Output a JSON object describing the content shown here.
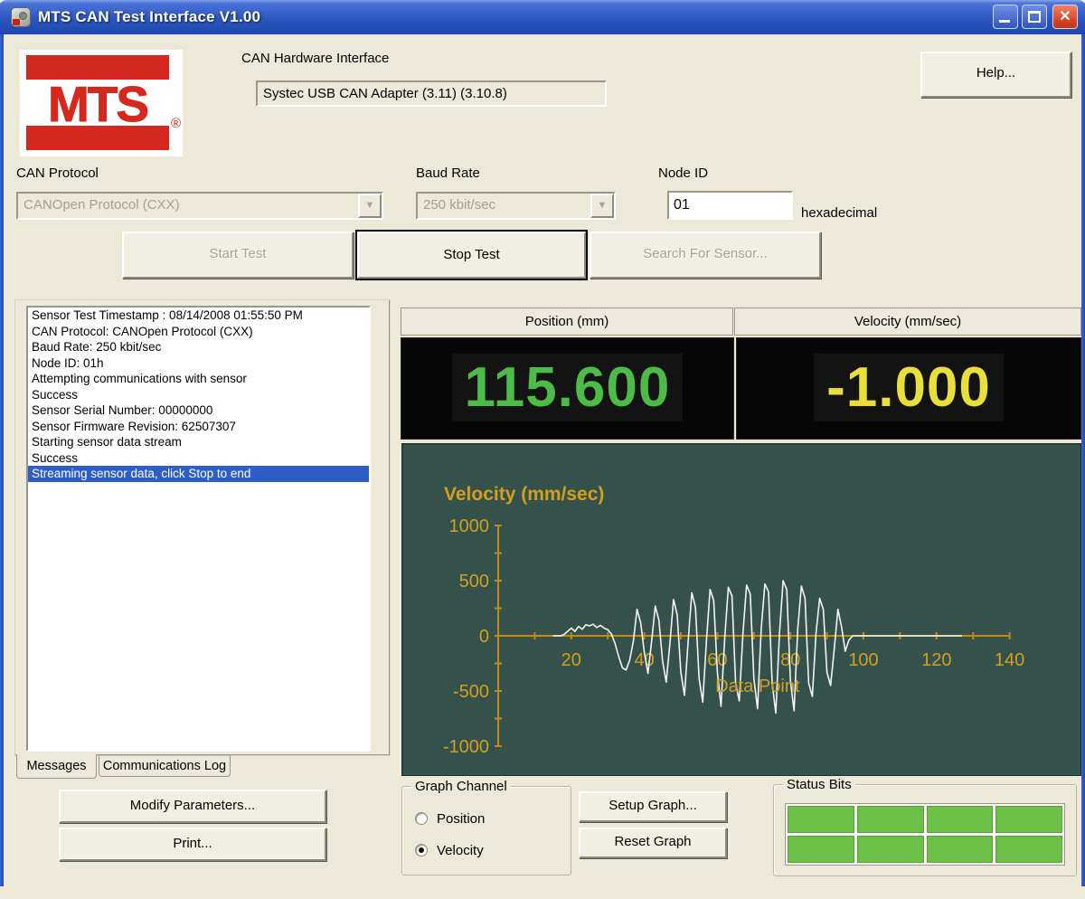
{
  "window": {
    "title": "MTS CAN Test Interface V1.00",
    "close_glyph": "✕"
  },
  "header": {
    "logo_text": "MTS",
    "logo_registered": "®",
    "hardware_label": "CAN Hardware Interface",
    "hardware_value": "Systec USB CAN Adapter (3.11) (3.10.8)",
    "help_label": "Help..."
  },
  "settings": {
    "can_protocol": {
      "label": "CAN Protocol",
      "value": "CANOpen Protocol (CXX)"
    },
    "baud_rate": {
      "label": "Baud Rate",
      "value": "250 kbit/sec"
    },
    "node_id": {
      "label": "Node ID",
      "value": "01",
      "suffix": "hexadecimal"
    },
    "dropdown_glyph": "▼"
  },
  "actions": {
    "start": "Start Test",
    "stop": "Stop Test",
    "search": "Search For Sensor..."
  },
  "log": {
    "tabs": [
      "Messages",
      "Communications Log"
    ],
    "active_tab": "Messages",
    "selected_index": 10,
    "messages": [
      "Sensor Test Timestamp : 08/14/2008 01:55:50 PM",
      "CAN Protocol: CANOpen Protocol (CXX)",
      "Baud Rate: 250 kbit/sec",
      "Node ID: 01h",
      "Attempting communications with sensor",
      "Success",
      "Sensor Serial Number: 00000000",
      "Sensor Firmware Revision: 62507307",
      "Starting sensor data stream",
      "Success",
      "Streaming sensor data, click Stop to end"
    ],
    "buttons": {
      "modify": "Modify Parameters...",
      "print": "Print..."
    }
  },
  "displays": {
    "position": {
      "header": "Position (mm)",
      "value": "115.600",
      "color": "#4CBB48"
    },
    "velocity": {
      "header": "Velocity (mm/sec)",
      "value": "-1.000",
      "color": "#E8DE3C"
    }
  },
  "chart_data": {
    "type": "line",
    "title": "Velocity (mm/sec)",
    "xlabel": "Data Point",
    "ylabel": "",
    "xlim": [
      0,
      140
    ],
    "ylim": [
      -1000,
      1000
    ],
    "x_major_ticks": [
      20,
      40,
      60,
      80,
      100,
      120,
      140
    ],
    "x_minor_step": 10,
    "y_major_ticks": [
      -1000,
      -500,
      0,
      500,
      1000
    ],
    "y_minor_step": 250,
    "grid": false,
    "bg_color": "#35514C",
    "axis_color": "#BE8C14",
    "label_color": "#D2A01E",
    "line_color": "#F2F5F2",
    "series": [
      {
        "name": "Velocity",
        "points": [
          [
            15,
            0
          ],
          [
            17,
            0
          ],
          [
            18,
            10
          ],
          [
            19,
            40
          ],
          [
            20,
            70
          ],
          [
            21,
            40
          ],
          [
            22,
            85
          ],
          [
            23,
            60
          ],
          [
            24,
            100
          ],
          [
            25,
            90
          ],
          [
            26,
            105
          ],
          [
            27,
            75
          ],
          [
            28,
            95
          ],
          [
            29,
            70
          ],
          [
            30,
            55
          ],
          [
            31,
            15
          ],
          [
            32,
            -70
          ],
          [
            33,
            -190
          ],
          [
            34,
            -290
          ],
          [
            35,
            -310
          ],
          [
            36,
            -220
          ],
          [
            37,
            -50
          ],
          [
            38,
            240
          ],
          [
            39,
            120
          ],
          [
            40,
            -150
          ],
          [
            41,
            -340
          ],
          [
            42,
            -50
          ],
          [
            43,
            270
          ],
          [
            44,
            140
          ],
          [
            45,
            -230
          ],
          [
            46,
            -420
          ],
          [
            47,
            -70
          ],
          [
            48,
            330
          ],
          [
            49,
            190
          ],
          [
            50,
            -330
          ],
          [
            51,
            -540
          ],
          [
            52,
            -50
          ],
          [
            53,
            390
          ],
          [
            54,
            260
          ],
          [
            55,
            -390
          ],
          [
            56,
            -600
          ],
          [
            57,
            -50
          ],
          [
            58,
            420
          ],
          [
            59,
            320
          ],
          [
            60,
            -330
          ],
          [
            61,
            -640
          ],
          [
            62,
            -30
          ],
          [
            63,
            440
          ],
          [
            64,
            360
          ],
          [
            65,
            -430
          ],
          [
            66,
            -590
          ],
          [
            67,
            20
          ],
          [
            68,
            460
          ],
          [
            69,
            380
          ],
          [
            70,
            -390
          ],
          [
            71,
            -660
          ],
          [
            72,
            60
          ],
          [
            73,
            470
          ],
          [
            74,
            400
          ],
          [
            75,
            -430
          ],
          [
            76,
            -700
          ],
          [
            77,
            20
          ],
          [
            78,
            500
          ],
          [
            79,
            420
          ],
          [
            80,
            -410
          ],
          [
            81,
            -680
          ],
          [
            82,
            60
          ],
          [
            83,
            450
          ],
          [
            84,
            340
          ],
          [
            85,
            -430
          ],
          [
            86,
            -550
          ],
          [
            87,
            20
          ],
          [
            88,
            340
          ],
          [
            89,
            240
          ],
          [
            90,
            -330
          ],
          [
            91,
            -450
          ],
          [
            92,
            -120
          ],
          [
            93,
            240
          ],
          [
            94,
            80
          ],
          [
            95,
            -140
          ],
          [
            96,
            -40
          ],
          [
            97,
            0
          ],
          [
            105,
            0
          ],
          [
            115,
            0
          ],
          [
            127,
            0
          ]
        ]
      }
    ]
  },
  "graph_channel": {
    "label": "Graph Channel",
    "options": [
      {
        "label": "Position",
        "selected": false
      },
      {
        "label": "Velocity",
        "selected": true
      }
    ]
  },
  "graph_buttons": {
    "setup": "Setup Graph...",
    "reset": "Reset Graph"
  },
  "status_bits": {
    "label": "Status Bits",
    "rows": 2,
    "cols": 4,
    "on_color": "#6CBF47"
  }
}
